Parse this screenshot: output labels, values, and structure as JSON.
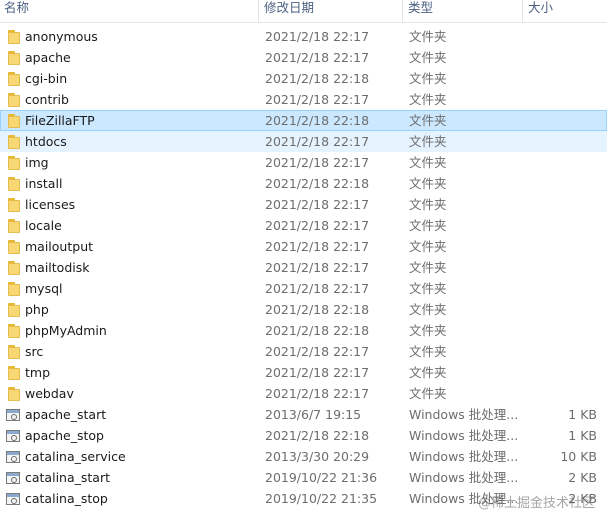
{
  "columns": {
    "name": "名称",
    "date": "修改日期",
    "type": "类型",
    "size": "大小"
  },
  "files": [
    {
      "name": "anonymous",
      "date": "2021/2/18 22:17",
      "type": "文件夹",
      "size": "",
      "kind": "folder"
    },
    {
      "name": "apache",
      "date": "2021/2/18 22:17",
      "type": "文件夹",
      "size": "",
      "kind": "folder"
    },
    {
      "name": "cgi-bin",
      "date": "2021/2/18 22:18",
      "type": "文件夹",
      "size": "",
      "kind": "folder"
    },
    {
      "name": "contrib",
      "date": "2021/2/18 22:17",
      "type": "文件夹",
      "size": "",
      "kind": "folder"
    },
    {
      "name": "FileZillaFTP",
      "date": "2021/2/18 22:18",
      "type": "文件夹",
      "size": "",
      "kind": "folder",
      "state": "selected"
    },
    {
      "name": "htdocs",
      "date": "2021/2/18 22:17",
      "type": "文件夹",
      "size": "",
      "kind": "folder",
      "state": "hover"
    },
    {
      "name": "img",
      "date": "2021/2/18 22:17",
      "type": "文件夹",
      "size": "",
      "kind": "folder"
    },
    {
      "name": "install",
      "date": "2021/2/18 22:18",
      "type": "文件夹",
      "size": "",
      "kind": "folder"
    },
    {
      "name": "licenses",
      "date": "2021/2/18 22:17",
      "type": "文件夹",
      "size": "",
      "kind": "folder"
    },
    {
      "name": "locale",
      "date": "2021/2/18 22:17",
      "type": "文件夹",
      "size": "",
      "kind": "folder"
    },
    {
      "name": "mailoutput",
      "date": "2021/2/18 22:17",
      "type": "文件夹",
      "size": "",
      "kind": "folder"
    },
    {
      "name": "mailtodisk",
      "date": "2021/2/18 22:17",
      "type": "文件夹",
      "size": "",
      "kind": "folder"
    },
    {
      "name": "mysql",
      "date": "2021/2/18 22:17",
      "type": "文件夹",
      "size": "",
      "kind": "folder"
    },
    {
      "name": "php",
      "date": "2021/2/18 22:18",
      "type": "文件夹",
      "size": "",
      "kind": "folder"
    },
    {
      "name": "phpMyAdmin",
      "date": "2021/2/18 22:18",
      "type": "文件夹",
      "size": "",
      "kind": "folder"
    },
    {
      "name": "src",
      "date": "2021/2/18 22:17",
      "type": "文件夹",
      "size": "",
      "kind": "folder"
    },
    {
      "name": "tmp",
      "date": "2021/2/18 22:17",
      "type": "文件夹",
      "size": "",
      "kind": "folder"
    },
    {
      "name": "webdav",
      "date": "2021/2/18 22:17",
      "type": "文件夹",
      "size": "",
      "kind": "folder"
    },
    {
      "name": "apache_start",
      "date": "2013/6/7 19:15",
      "type": "Windows 批处理...",
      "size": "1 KB",
      "kind": "batch"
    },
    {
      "name": "apache_stop",
      "date": "2021/2/18 22:18",
      "type": "Windows 批处理...",
      "size": "1 KB",
      "kind": "batch"
    },
    {
      "name": "catalina_service",
      "date": "2013/3/30 20:29",
      "type": "Windows 批处理...",
      "size": "10 KB",
      "kind": "batch"
    },
    {
      "name": "catalina_start",
      "date": "2019/10/22 21:36",
      "type": "Windows 批处理...",
      "size": "2 KB",
      "kind": "batch"
    },
    {
      "name": "catalina_stop",
      "date": "2019/10/22 21:35",
      "type": "Windows 批处理...",
      "size": "2 KB",
      "kind": "batch"
    }
  ],
  "icons": {
    "folder": "folder-icon",
    "batch": "batch-file-icon"
  },
  "colors": {
    "selected_bg": "#cce8ff",
    "selected_border": "#99d1ff",
    "hover_bg": "#e5f3ff",
    "folder": "#f8d775"
  },
  "watermark": "@稀土掘金技术社区"
}
